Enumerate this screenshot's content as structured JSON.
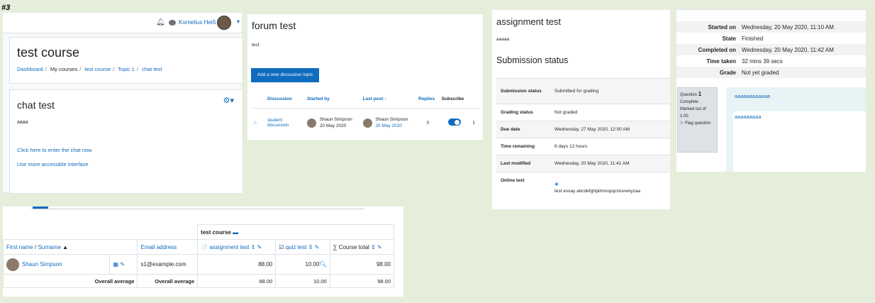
{
  "tag": "#3",
  "course_page": {
    "user_name": "Kornelius Heiß",
    "course_title": "test course",
    "breadcrumb": [
      "Dashboard",
      "My courses",
      "test course",
      "Topic 1",
      "chat test"
    ],
    "activity_title": "chat test",
    "intro": "aaaa",
    "enter_link": "Click here to enter the chat now",
    "accessible_link": "Use more accessible interface"
  },
  "forum": {
    "title": "forum test",
    "intro": "test",
    "add_button": "Add a new discussion topic",
    "columns": [
      "Discussion",
      "Started by",
      "Last post",
      "Replies",
      "Subscribe"
    ],
    "row": {
      "discussion": "student discussion",
      "started_by": "Shaun Simpson",
      "started_date": "20 May 2020",
      "last_by": "Shaun Simpson",
      "last_date": "20 May 2020",
      "replies": "0"
    }
  },
  "assignment": {
    "title": "assignment test",
    "intro": "aaaaa",
    "status_heading": "Submission status",
    "rows": [
      {
        "k": "Submission status",
        "v": "Submitted for grading"
      },
      {
        "k": "Grading status",
        "v": "Not graded"
      },
      {
        "k": "Due date",
        "v": "Wednesday, 27 May 2020, 12:00 AM"
      },
      {
        "k": "Time remaining",
        "v": "6 days 12 hours"
      },
      {
        "k": "Last modified",
        "v": "Wednesday, 20 May 2020, 11:41 AM"
      },
      {
        "k": "Online text",
        "v": "test essay abcdefghijklmnopqrstuvwxyzaa"
      }
    ]
  },
  "quiz_review": {
    "summary": [
      {
        "k": "Started on",
        "v": "Wednesday, 20 May 2020, 11:10 AM"
      },
      {
        "k": "State",
        "v": "Finished"
      },
      {
        "k": "Completed on",
        "v": "Wednesday, 20 May 2020, 11:42 AM"
      },
      {
        "k": "Time taken",
        "v": "32 mins 39 secs"
      },
      {
        "k": "Grade",
        "v": "Not yet graded"
      }
    ],
    "question_label": "Question",
    "question_number": "1",
    "question_state": "Complete",
    "marked_out_of": "Marked out of 1.00",
    "flag": "Flag question",
    "question_text": "aaaaaaaaaaaa",
    "answer_text": "aaaaaaaaa"
  },
  "grader": {
    "category": "test course",
    "name_header_first": "First name",
    "name_header_last": "Surname",
    "email_header": "Email address",
    "items": [
      "assignment test",
      "quiz test",
      "Course total"
    ],
    "student": {
      "name": "Shaun Simpson",
      "email": "s1@example.com",
      "grades": [
        "88.00",
        "10.00",
        "98.00"
      ]
    },
    "average_label": "Overall average",
    "averages": [
      "88.00",
      "10.00",
      "98.00"
    ]
  }
}
